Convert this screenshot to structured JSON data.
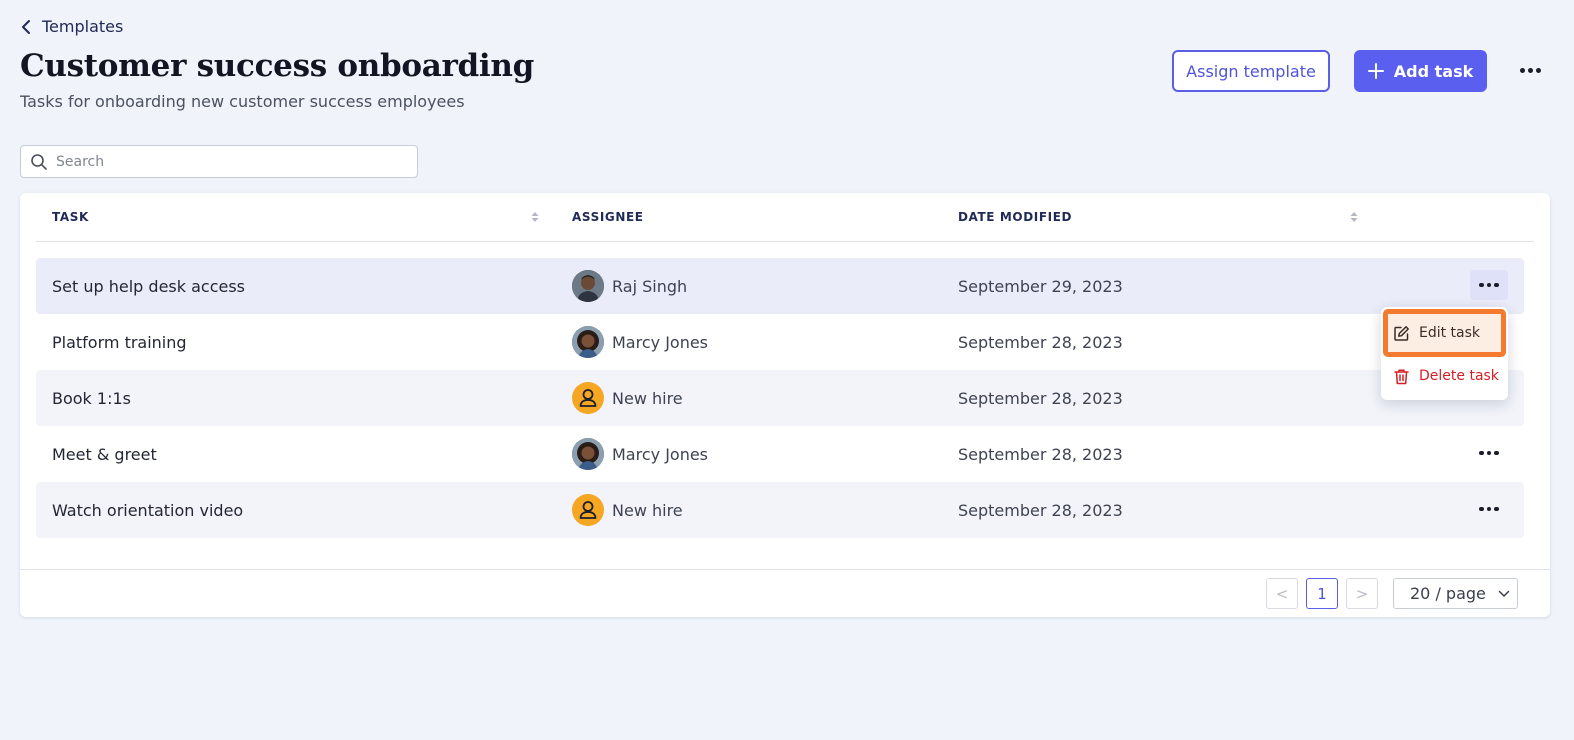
{
  "breadcrumb": {
    "back_label": "Templates"
  },
  "header": {
    "title": "Customer success onboarding",
    "subtitle": "Tasks for onboarding new customer success employees",
    "assign_label": "Assign template",
    "add_label": "Add task"
  },
  "search": {
    "placeholder": "Search"
  },
  "table": {
    "columns": {
      "task": "TASK",
      "assignee": "ASSIGNEE",
      "date": "DATE MODIFIED"
    },
    "rows": [
      {
        "task": "Set up help desk access",
        "assignee": "Raj Singh",
        "avatar": "photo",
        "date": "September 29, 2023"
      },
      {
        "task": "Platform training",
        "assignee": "Marcy Jones",
        "avatar": "photo",
        "date": "September 28, 2023"
      },
      {
        "task": "Book 1:1s",
        "assignee": "New hire",
        "avatar": "user-icon",
        "date": "September 28, 2023"
      },
      {
        "task": "Meet & greet",
        "assignee": "Marcy Jones",
        "avatar": "photo",
        "date": "September 28, 2023"
      },
      {
        "task": "Watch orientation video",
        "assignee": "New hire",
        "avatar": "user-icon",
        "date": "September 28, 2023"
      }
    ]
  },
  "row_menu": {
    "edit_label": "Edit task",
    "delete_label": "Delete task"
  },
  "pagination": {
    "current_page": "1",
    "prev": "<",
    "next": ">",
    "per_page": "20 / page"
  },
  "colors": {
    "primary": "#5b5ff0",
    "highlight": "#f37a2e",
    "danger": "#d32027",
    "generic_avatar": "#f5a623"
  }
}
